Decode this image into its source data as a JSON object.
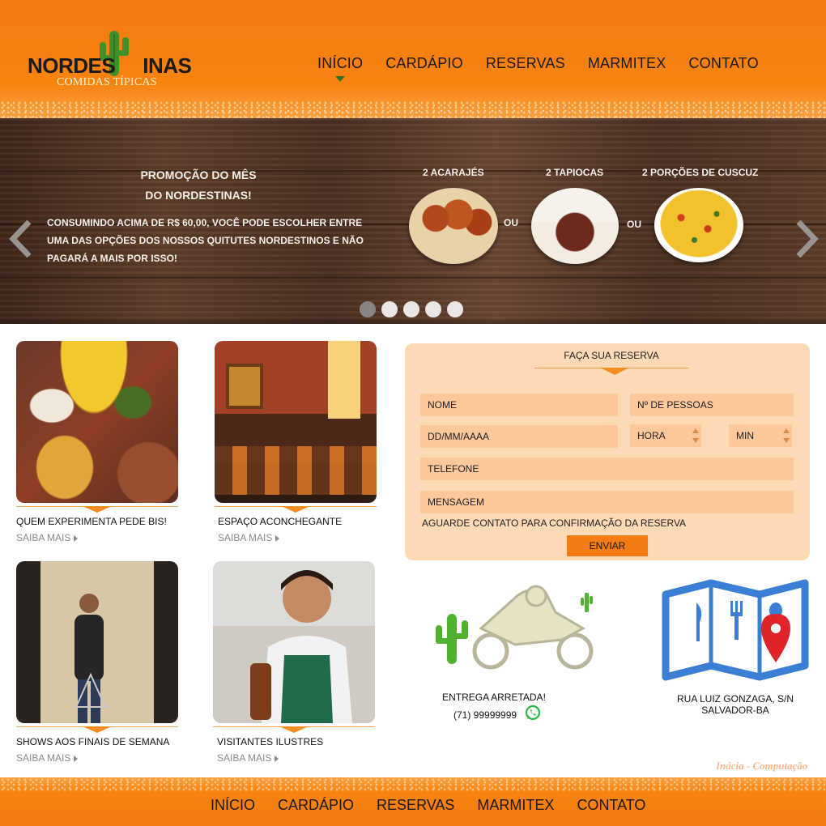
{
  "brand": {
    "logo_part1": "NORDES",
    "logo_part2": "INAS",
    "tagline": "COMIDAS TÍPICAS"
  },
  "nav": {
    "items": [
      {
        "label": "INÍCIO",
        "active": true
      },
      {
        "label": "CARDÁPIO",
        "active": false
      },
      {
        "label": "RESERVAS",
        "active": false
      },
      {
        "label": "MARMITEX",
        "active": false
      },
      {
        "label": "CONTATO",
        "active": false
      }
    ]
  },
  "slider": {
    "title_line1": "PROMOÇÃO DO MÊS",
    "title_line2": "DO NORDESTINAS!",
    "description": "CONSUMINDO ACIMA DE R$ 60,00, VOCÊ PODE  ESCOLHER ENTRE UMA DAS OPÇÕES DOS NOSSOS QUITUTES NORDESTINOS E NÃO PAGARÁ A MAIS POR ISSO!",
    "offers": [
      "2 ACARAJÉS",
      "2 TAPIOCAS",
      "2 PORÇÕES DE CUSCUZ"
    ],
    "separator": "OU",
    "slide_count": 5,
    "active_slide": 1,
    "prev_icon": "chevron-left-icon",
    "next_icon": "chevron-right-icon"
  },
  "features": [
    {
      "caption": "QUEM EXPERIMENTA PEDE BIS!",
      "more": "SAIBA MAIS"
    },
    {
      "caption": "ESPAÇO ACONCHEGANTE",
      "more": "SAIBA MAIS"
    },
    {
      "caption": "SHOWS AOS FINAIS DE SEMANA",
      "more": "SAIBA MAIS"
    },
    {
      "caption": "VISITANTES ILUSTRES",
      "more": "SAIBA MAIS"
    }
  ],
  "reservation": {
    "title": "FAÇA SUA RESERVA",
    "name_placeholder": "NOME",
    "people_placeholder": "Nº DE PESSOAS",
    "date_placeholder": "DD/MM/AAAA",
    "hour_placeholder": "HORA",
    "minute_placeholder": "MIN",
    "phone_placeholder": "TELEFONE",
    "message_placeholder": "MENSAGEM",
    "note": "AGUARDE CONTATO PARA CONFIRMAÇÃO DA RESERVA",
    "submit_label": "ENVIAR"
  },
  "delivery": {
    "label": "ENTREGA ARRETADA!",
    "phone": "(71) 99999999",
    "icon": "whatsapp-icon"
  },
  "address": {
    "line1": "RUA LUIZ GONZAGA, S/N",
    "line2": "SALVADOR-BA",
    "icon": "map-pin-icon"
  },
  "credit": "Inácia - Computação",
  "footer_nav": [
    "INÍCIO",
    "CARDÁPIO",
    "RESERVAS",
    "MARMITEX",
    "CONTATO"
  ],
  "colors": {
    "brand_orange": "#f57a10",
    "form_bg": "#fdd9b6",
    "field_bg": "#fcc79a",
    "accent_green": "#3b6d2b"
  }
}
